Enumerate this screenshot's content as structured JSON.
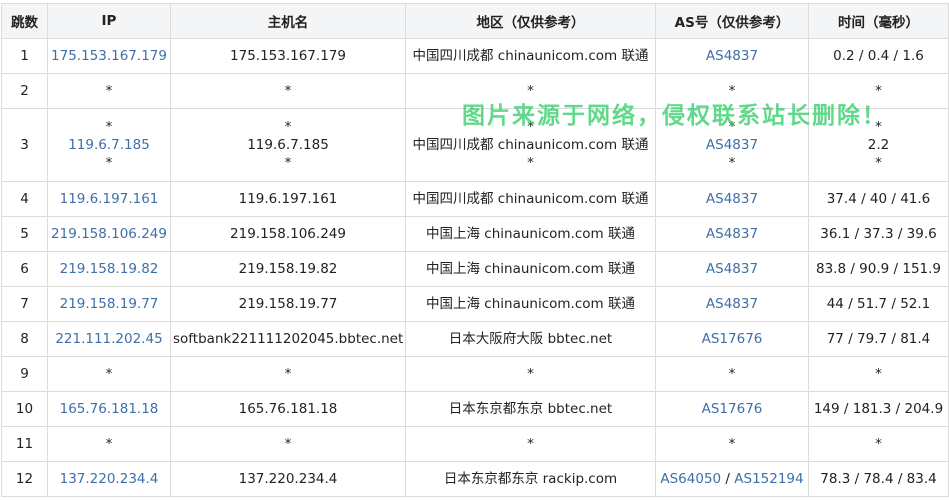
{
  "headers": {
    "hop": "跳数",
    "ip": "IP",
    "host": "主机名",
    "region": "地区（仅供参考）",
    "as": "AS号（仅供参考）",
    "time": "时间（毫秒）"
  },
  "rows": [
    {
      "hop": "1",
      "ip": "175.153.167.179",
      "host": "175.153.167.179",
      "region": "中国四川成都 chinaunicom.com 联通",
      "as": "AS4837",
      "time": "0.2 / 0.4 / 1.6"
    },
    {
      "hop": "2",
      "ip": "*",
      "host": "*",
      "region": "*",
      "as": "*",
      "time": "*"
    },
    {
      "hop": "3",
      "ip_lines": [
        "*",
        "119.6.7.185",
        "*"
      ],
      "host_lines": [
        "*",
        "119.6.7.185",
        "*"
      ],
      "region_lines": [
        "*",
        "中国四川成都 chinaunicom.com 联通",
        "*"
      ],
      "as_lines": [
        "*",
        "AS4837",
        "*"
      ],
      "time_lines": [
        "*",
        "2.2",
        "*"
      ]
    },
    {
      "hop": "4",
      "ip": "119.6.197.161",
      "host": "119.6.197.161",
      "region": "中国四川成都 chinaunicom.com 联通",
      "as": "AS4837",
      "time": "37.4 / 40 / 41.6"
    },
    {
      "hop": "5",
      "ip": "219.158.106.249",
      "host": "219.158.106.249",
      "region": "中国上海 chinaunicom.com 联通",
      "as": "AS4837",
      "time": "36.1 / 37.3 / 39.6"
    },
    {
      "hop": "6",
      "ip": "219.158.19.82",
      "host": "219.158.19.82",
      "region": "中国上海 chinaunicom.com 联通",
      "as": "AS4837",
      "time": "83.8 / 90.9 / 151.9"
    },
    {
      "hop": "7",
      "ip": "219.158.19.77",
      "host": "219.158.19.77",
      "region": "中国上海 chinaunicom.com 联通",
      "as": "AS4837",
      "time": "44 / 51.7 / 52.1"
    },
    {
      "hop": "8",
      "ip": "221.111.202.45",
      "host": "softbank221111202045.bbtec.net",
      "region": "日本大阪府大阪 bbtec.net",
      "as": "AS17676",
      "time": "77 / 79.7 / 81.4"
    },
    {
      "hop": "9",
      "ip": "*",
      "host": "*",
      "region": "*",
      "as": "*",
      "time": "*"
    },
    {
      "hop": "10",
      "ip": "165.76.181.18",
      "host": "165.76.181.18",
      "region": "日本东京都东京 bbtec.net",
      "as": "AS17676",
      "time": "149 / 181.3 / 204.9"
    },
    {
      "hop": "11",
      "ip": "*",
      "host": "*",
      "region": "*",
      "as": "*",
      "time": "*"
    },
    {
      "hop": "12",
      "ip": "137.220.234.4",
      "host": "137.220.234.4",
      "region": "日本东京都东京 rackip.com",
      "as_a": "AS64050",
      "as_sep": " / ",
      "as_b": "AS152194",
      "time": "78.3 / 78.4 / 83.4"
    }
  ],
  "watermark": "图片来源于网络，侵权联系站长删除！",
  "colors": {
    "link": "#3f6fa8",
    "header_bg": "#f4f5f7",
    "border": "#dcdcdc",
    "watermark": "#34d06a"
  }
}
